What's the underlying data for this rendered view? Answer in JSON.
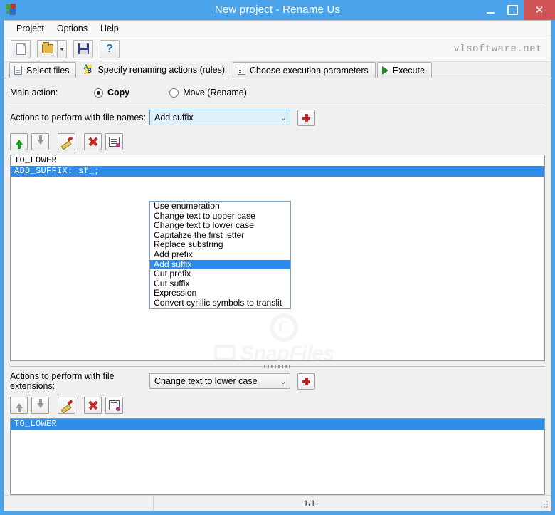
{
  "window": {
    "title": "New project - Rename Us",
    "icon": "app-icon",
    "controls": {
      "minimize": "–",
      "maximize": "□",
      "close": "✕"
    }
  },
  "menu": {
    "items": [
      {
        "label": "Project"
      },
      {
        "label": "Options"
      },
      {
        "label": "Help"
      }
    ]
  },
  "toolbar": {
    "buttons": [
      {
        "icon": "new-file-icon"
      },
      {
        "icon": "open-folder-icon"
      },
      {
        "icon": "save-icon"
      },
      {
        "icon": "help-icon"
      }
    ],
    "brand": "vlsoftware.net"
  },
  "tabs": [
    {
      "label": "Select files",
      "icon": "documents-icon",
      "active": false
    },
    {
      "label": "Specify renaming actions (rules)",
      "icon": "ab-letters-icon",
      "active": true
    },
    {
      "label": "Choose execution parameters",
      "icon": "clipboard-icon",
      "active": false
    },
    {
      "label": "Execute",
      "icon": "play-icon",
      "active": false
    }
  ],
  "main_action": {
    "label": "Main action:",
    "options": [
      {
        "label": "Copy",
        "selected": true
      },
      {
        "label": "Move (Rename)",
        "selected": false
      }
    ]
  },
  "names_section": {
    "label": "Actions to perform with file names:",
    "combo_value": "Add suffix",
    "add_button": "add-rule-button",
    "toolbar_icons": [
      "move-up-icon",
      "move-down-icon",
      "edit-icon",
      "delete-icon",
      "properties-icon"
    ],
    "rules": [
      {
        "text": "TO_LOWER",
        "selected": false
      },
      {
        "text": "ADD_SUFFIX: sf_;",
        "selected": true
      }
    ]
  },
  "dropdown": {
    "open": true,
    "items": [
      {
        "label": "Use enumeration",
        "selected": false
      },
      {
        "label": "Change text to upper case",
        "selected": false
      },
      {
        "label": "Change text to lower case",
        "selected": false
      },
      {
        "label": "Capitalize the first letter",
        "selected": false
      },
      {
        "label": "Replace substring",
        "selected": false
      },
      {
        "label": "Add prefix",
        "selected": false
      },
      {
        "label": "Add suffix",
        "selected": true
      },
      {
        "label": "Cut prefix",
        "selected": false
      },
      {
        "label": "Cut suffix",
        "selected": false
      },
      {
        "label": "Expression",
        "selected": false
      },
      {
        "label": "Convert cyrillic symbols to translit",
        "selected": false
      }
    ]
  },
  "extensions_section": {
    "label": "Actions to perform with file extensions:",
    "combo_value": "Change text to lower case",
    "add_button": "add-extension-rule-button",
    "toolbar_icons": [
      "move-up-icon",
      "move-down-icon",
      "edit-icon",
      "delete-icon",
      "properties-icon"
    ],
    "rules": [
      {
        "text": "TO_LOWER",
        "selected": true
      }
    ]
  },
  "watermark": {
    "symbol": "C",
    "text": "SnapFiles"
  },
  "statusbar": {
    "left": "",
    "page": "1/1"
  },
  "colors": {
    "window_frame": "#4aa3ea",
    "selection": "#2f8ce8",
    "close_button": "#cf5355",
    "accent_red": "#c02026"
  }
}
